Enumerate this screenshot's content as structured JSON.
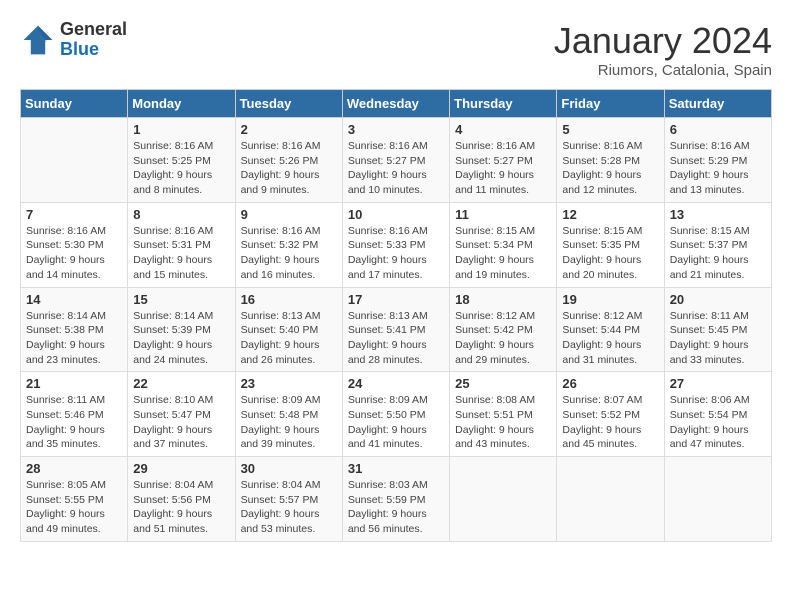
{
  "logo": {
    "line1": "General",
    "line2": "Blue"
  },
  "title": "January 2024",
  "location": "Riumors, Catalonia, Spain",
  "weekdays": [
    "Sunday",
    "Monday",
    "Tuesday",
    "Wednesday",
    "Thursday",
    "Friday",
    "Saturday"
  ],
  "weeks": [
    [
      {
        "day": "",
        "sunrise": "",
        "sunset": "",
        "daylight": ""
      },
      {
        "day": "1",
        "sunrise": "Sunrise: 8:16 AM",
        "sunset": "Sunset: 5:25 PM",
        "daylight": "Daylight: 9 hours and 8 minutes."
      },
      {
        "day": "2",
        "sunrise": "Sunrise: 8:16 AM",
        "sunset": "Sunset: 5:26 PM",
        "daylight": "Daylight: 9 hours and 9 minutes."
      },
      {
        "day": "3",
        "sunrise": "Sunrise: 8:16 AM",
        "sunset": "Sunset: 5:27 PM",
        "daylight": "Daylight: 9 hours and 10 minutes."
      },
      {
        "day": "4",
        "sunrise": "Sunrise: 8:16 AM",
        "sunset": "Sunset: 5:27 PM",
        "daylight": "Daylight: 9 hours and 11 minutes."
      },
      {
        "day": "5",
        "sunrise": "Sunrise: 8:16 AM",
        "sunset": "Sunset: 5:28 PM",
        "daylight": "Daylight: 9 hours and 12 minutes."
      },
      {
        "day": "6",
        "sunrise": "Sunrise: 8:16 AM",
        "sunset": "Sunset: 5:29 PM",
        "daylight": "Daylight: 9 hours and 13 minutes."
      }
    ],
    [
      {
        "day": "7",
        "sunrise": "Sunrise: 8:16 AM",
        "sunset": "Sunset: 5:30 PM",
        "daylight": "Daylight: 9 hours and 14 minutes."
      },
      {
        "day": "8",
        "sunrise": "Sunrise: 8:16 AM",
        "sunset": "Sunset: 5:31 PM",
        "daylight": "Daylight: 9 hours and 15 minutes."
      },
      {
        "day": "9",
        "sunrise": "Sunrise: 8:16 AM",
        "sunset": "Sunset: 5:32 PM",
        "daylight": "Daylight: 9 hours and 16 minutes."
      },
      {
        "day": "10",
        "sunrise": "Sunrise: 8:16 AM",
        "sunset": "Sunset: 5:33 PM",
        "daylight": "Daylight: 9 hours and 17 minutes."
      },
      {
        "day": "11",
        "sunrise": "Sunrise: 8:15 AM",
        "sunset": "Sunset: 5:34 PM",
        "daylight": "Daylight: 9 hours and 19 minutes."
      },
      {
        "day": "12",
        "sunrise": "Sunrise: 8:15 AM",
        "sunset": "Sunset: 5:35 PM",
        "daylight": "Daylight: 9 hours and 20 minutes."
      },
      {
        "day": "13",
        "sunrise": "Sunrise: 8:15 AM",
        "sunset": "Sunset: 5:37 PM",
        "daylight": "Daylight: 9 hours and 21 minutes."
      }
    ],
    [
      {
        "day": "14",
        "sunrise": "Sunrise: 8:14 AM",
        "sunset": "Sunset: 5:38 PM",
        "daylight": "Daylight: 9 hours and 23 minutes."
      },
      {
        "day": "15",
        "sunrise": "Sunrise: 8:14 AM",
        "sunset": "Sunset: 5:39 PM",
        "daylight": "Daylight: 9 hours and 24 minutes."
      },
      {
        "day": "16",
        "sunrise": "Sunrise: 8:13 AM",
        "sunset": "Sunset: 5:40 PM",
        "daylight": "Daylight: 9 hours and 26 minutes."
      },
      {
        "day": "17",
        "sunrise": "Sunrise: 8:13 AM",
        "sunset": "Sunset: 5:41 PM",
        "daylight": "Daylight: 9 hours and 28 minutes."
      },
      {
        "day": "18",
        "sunrise": "Sunrise: 8:12 AM",
        "sunset": "Sunset: 5:42 PM",
        "daylight": "Daylight: 9 hours and 29 minutes."
      },
      {
        "day": "19",
        "sunrise": "Sunrise: 8:12 AM",
        "sunset": "Sunset: 5:44 PM",
        "daylight": "Daylight: 9 hours and 31 minutes."
      },
      {
        "day": "20",
        "sunrise": "Sunrise: 8:11 AM",
        "sunset": "Sunset: 5:45 PM",
        "daylight": "Daylight: 9 hours and 33 minutes."
      }
    ],
    [
      {
        "day": "21",
        "sunrise": "Sunrise: 8:11 AM",
        "sunset": "Sunset: 5:46 PM",
        "daylight": "Daylight: 9 hours and 35 minutes."
      },
      {
        "day": "22",
        "sunrise": "Sunrise: 8:10 AM",
        "sunset": "Sunset: 5:47 PM",
        "daylight": "Daylight: 9 hours and 37 minutes."
      },
      {
        "day": "23",
        "sunrise": "Sunrise: 8:09 AM",
        "sunset": "Sunset: 5:48 PM",
        "daylight": "Daylight: 9 hours and 39 minutes."
      },
      {
        "day": "24",
        "sunrise": "Sunrise: 8:09 AM",
        "sunset": "Sunset: 5:50 PM",
        "daylight": "Daylight: 9 hours and 41 minutes."
      },
      {
        "day": "25",
        "sunrise": "Sunrise: 8:08 AM",
        "sunset": "Sunset: 5:51 PM",
        "daylight": "Daylight: 9 hours and 43 minutes."
      },
      {
        "day": "26",
        "sunrise": "Sunrise: 8:07 AM",
        "sunset": "Sunset: 5:52 PM",
        "daylight": "Daylight: 9 hours and 45 minutes."
      },
      {
        "day": "27",
        "sunrise": "Sunrise: 8:06 AM",
        "sunset": "Sunset: 5:54 PM",
        "daylight": "Daylight: 9 hours and 47 minutes."
      }
    ],
    [
      {
        "day": "28",
        "sunrise": "Sunrise: 8:05 AM",
        "sunset": "Sunset: 5:55 PM",
        "daylight": "Daylight: 9 hours and 49 minutes."
      },
      {
        "day": "29",
        "sunrise": "Sunrise: 8:04 AM",
        "sunset": "Sunset: 5:56 PM",
        "daylight": "Daylight: 9 hours and 51 minutes."
      },
      {
        "day": "30",
        "sunrise": "Sunrise: 8:04 AM",
        "sunset": "Sunset: 5:57 PM",
        "daylight": "Daylight: 9 hours and 53 minutes."
      },
      {
        "day": "31",
        "sunrise": "Sunrise: 8:03 AM",
        "sunset": "Sunset: 5:59 PM",
        "daylight": "Daylight: 9 hours and 56 minutes."
      },
      {
        "day": "",
        "sunrise": "",
        "sunset": "",
        "daylight": ""
      },
      {
        "day": "",
        "sunrise": "",
        "sunset": "",
        "daylight": ""
      },
      {
        "day": "",
        "sunrise": "",
        "sunset": "",
        "daylight": ""
      }
    ]
  ]
}
